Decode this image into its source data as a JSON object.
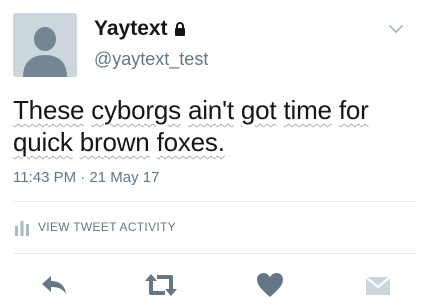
{
  "user": {
    "display_name": "Yaytext",
    "handle": "@yaytext_test",
    "protected": true
  },
  "tweet": {
    "text_words_line1": [
      "These",
      "cyborgs",
      "ain't",
      "got",
      "time",
      "for"
    ],
    "text_words_line2": [
      "quick",
      "brown",
      "foxes."
    ],
    "timestamp": "11:43 PM · 21 May 17"
  },
  "activity": {
    "label": "VIEW TWEET ACTIVITY"
  },
  "actions": [
    "reply",
    "retweet",
    "like",
    "direct-message"
  ],
  "colors": {
    "text_primary": "#14171a",
    "text_secondary": "#657786",
    "icon_gray": "#aab8c2",
    "divider": "#e6ecf0",
    "avatar_bg": "#ccd6dd",
    "avatar_fg": "#f5f8fa"
  }
}
